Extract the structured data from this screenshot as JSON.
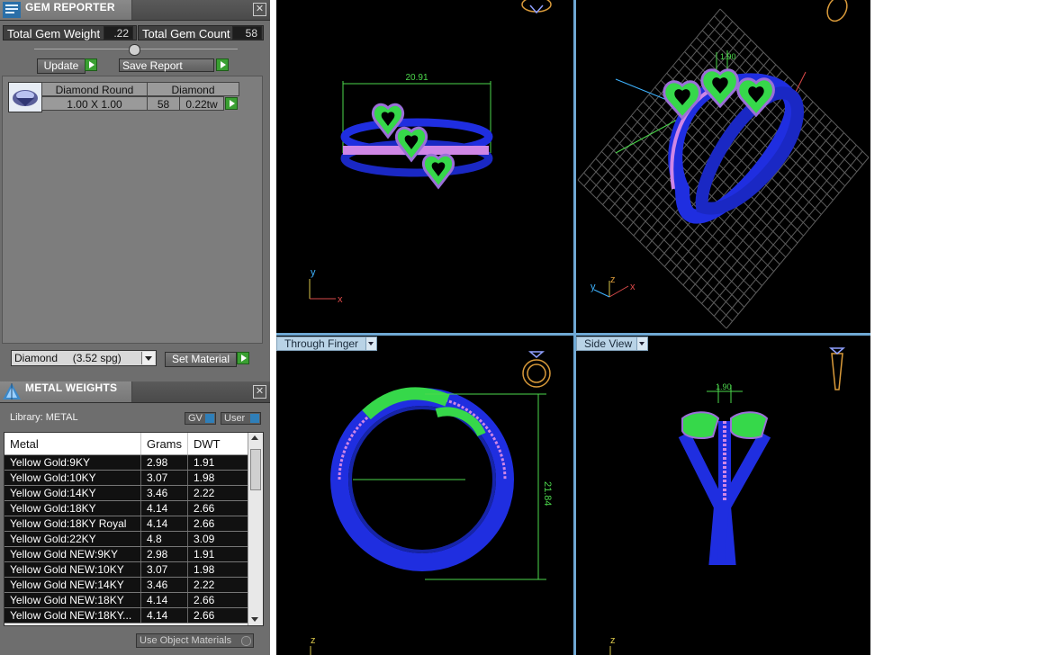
{
  "gem_reporter": {
    "title": "GEM REPORTER",
    "total_gem_weight_label": "Total Gem Weight",
    "total_gem_weight_value": ".22",
    "total_gem_count_label": "Total Gem Count",
    "total_gem_count_value": "58",
    "update_label": "Update",
    "save_report_label": "Save Report",
    "gem_row": {
      "header_1": "Diamond Round",
      "header_2": "Diamond",
      "size": "1.00 X 1.00",
      "count": "58",
      "weight": "0.22tw"
    },
    "material_dropdown": "Diamond     (3.52 spg)",
    "set_material_label": "Set Material"
  },
  "metal_weights": {
    "title": "METAL WEIGHTS",
    "library_label": "Library: METAL",
    "gv_label": "GV",
    "user_label": "User",
    "columns": [
      "Metal",
      "Grams",
      "DWT"
    ],
    "rows": [
      [
        "Yellow Gold:9KY",
        "2.98",
        "1.91"
      ],
      [
        "Yellow Gold:10KY",
        "3.07",
        "1.98"
      ],
      [
        "Yellow Gold:14KY",
        "3.46",
        "2.22"
      ],
      [
        "Yellow Gold:18KY",
        "4.14",
        "2.66"
      ],
      [
        "Yellow Gold:18KY Royal",
        "4.14",
        "2.66"
      ],
      [
        "Yellow Gold:22KY",
        "4.8",
        "3.09"
      ],
      [
        "Yellow Gold NEW:9KY",
        "2.98",
        "1.91"
      ],
      [
        "Yellow Gold NEW:10KY",
        "3.07",
        "1.98"
      ],
      [
        "Yellow Gold NEW:14KY",
        "3.46",
        "2.22"
      ],
      [
        "Yellow Gold NEW:18KY",
        "4.14",
        "2.66"
      ],
      [
        "Yellow Gold NEW:18KY...",
        "4.14",
        "2.66"
      ]
    ],
    "use_object_materials_label": "Use Object Materials"
  },
  "viewports": {
    "top": {
      "dimension": "20.91",
      "axis_y": "y",
      "axis_x": "x"
    },
    "perspective": {
      "dimension": "1.90",
      "axis_y": "y",
      "axis_z": "z",
      "axis_x": "x"
    },
    "front": {
      "label": "Through Finger",
      "dimension": "21.84",
      "axis_z": "z"
    },
    "side": {
      "label": "Side View",
      "dimension": "1.90",
      "axis_z": "z"
    }
  },
  "colors": {
    "ring_blue": "#1f2ee0",
    "gem_green": "#36d84a",
    "dimension_green": "#4cd84c",
    "grid": "#5c5c5c",
    "viewport_label_bg": "#b9d3e6",
    "panel_bg": "#6e6e6e"
  }
}
